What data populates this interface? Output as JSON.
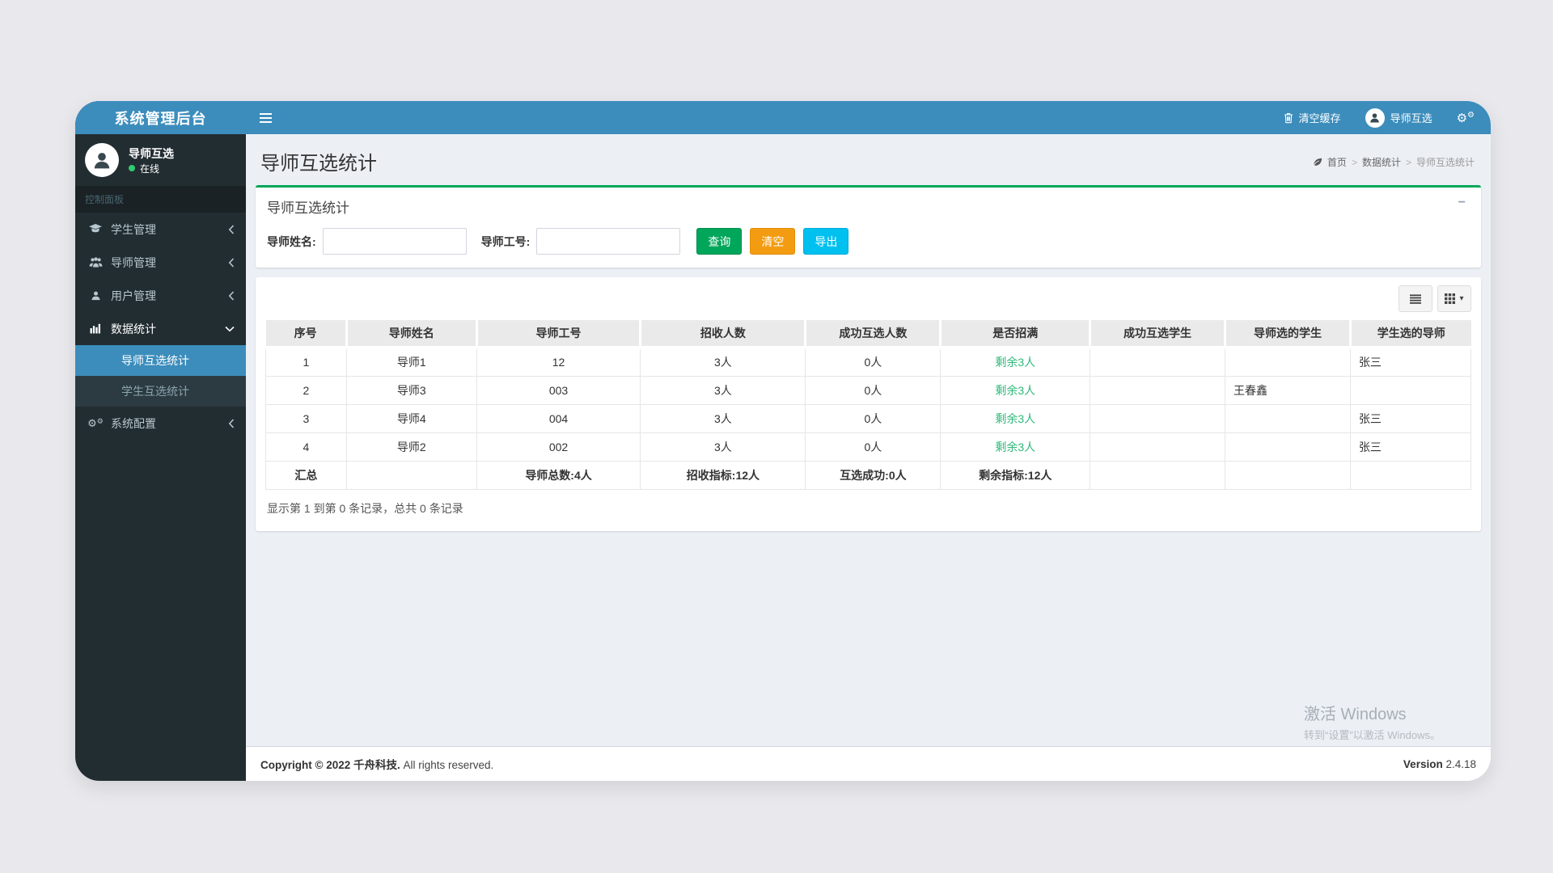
{
  "brand": "系统管理后台",
  "navbar": {
    "clear_cache": "清空缓存",
    "user_name": "导师互选"
  },
  "sidebar": {
    "user_name": "导师互选",
    "user_status": "在线",
    "section_label": "控制面板",
    "items": [
      {
        "label": "学生管理"
      },
      {
        "label": "导师管理"
      },
      {
        "label": "用户管理"
      },
      {
        "label": "数据统计"
      },
      {
        "label": "系统配置"
      }
    ],
    "subitems": [
      {
        "label": "导师互选统计"
      },
      {
        "label": "学生互选统计"
      }
    ]
  },
  "header": {
    "page_title": "导师互选统计",
    "breadcrumb": {
      "home": "首页",
      "section": "数据统计",
      "current": "导师互选统计"
    }
  },
  "filter": {
    "panel_title": "导师互选统计",
    "name_label": "导师姓名:",
    "id_label": "导师工号:",
    "search_btn": "查询",
    "clear_btn": "清空",
    "export_btn": "导出",
    "collapse_icon": "−"
  },
  "toolbar": {
    "caret": "▾"
  },
  "table": {
    "headers": [
      "序号",
      "导师姓名",
      "导师工号",
      "招收人数",
      "成功互选人数",
      "是否招满",
      "成功互选学生",
      "导师选的学生",
      "学生选的导师"
    ],
    "rows": [
      {
        "seq": "1",
        "name": "导师1",
        "code": "12",
        "quota": "3人",
        "mutual": "0人",
        "status": "剩余3人",
        "success": "",
        "picked_students": "",
        "picked_teachers": "张三"
      },
      {
        "seq": "2",
        "name": "导师3",
        "code": "003",
        "quota": "3人",
        "mutual": "0人",
        "status": "剩余3人",
        "success": "",
        "picked_students": "王春鑫",
        "picked_teachers": ""
      },
      {
        "seq": "3",
        "name": "导师4",
        "code": "004",
        "quota": "3人",
        "mutual": "0人",
        "status": "剩余3人",
        "success": "",
        "picked_students": "",
        "picked_teachers": "张三"
      },
      {
        "seq": "4",
        "name": "导师2",
        "code": "002",
        "quota": "3人",
        "mutual": "0人",
        "status": "剩余3人",
        "success": "",
        "picked_students": "",
        "picked_teachers": "张三"
      }
    ],
    "summary": {
      "label": "汇总",
      "teachers": {
        "label": "导师总数:",
        "value": "4人"
      },
      "quota": {
        "label": "招收指标:",
        "value": "12人"
      },
      "mutual": {
        "label": "互选成功:",
        "value": "0人"
      },
      "remain": {
        "label": "剩余指标:",
        "value": "12人"
      }
    },
    "record_info": "显示第 1 到第 0 条记录，总共 0 条记录"
  },
  "footer": {
    "copyright_bold": "Copyright © 2022 千舟科技.",
    "copyright_rest": " All rights reserved.",
    "version_label": "Version",
    "version_value": " 2.4.18"
  },
  "watermark": {
    "line1": "激活 Windows",
    "line2": "转到“设置”以激活 Windows。"
  },
  "colors": {
    "accent_blue": "#3c8dbc",
    "sidebar_dark": "#222d32",
    "green": "#00a65a",
    "orange": "#f39c12",
    "cyan": "#00c0ef",
    "table_green": "#2db978"
  }
}
